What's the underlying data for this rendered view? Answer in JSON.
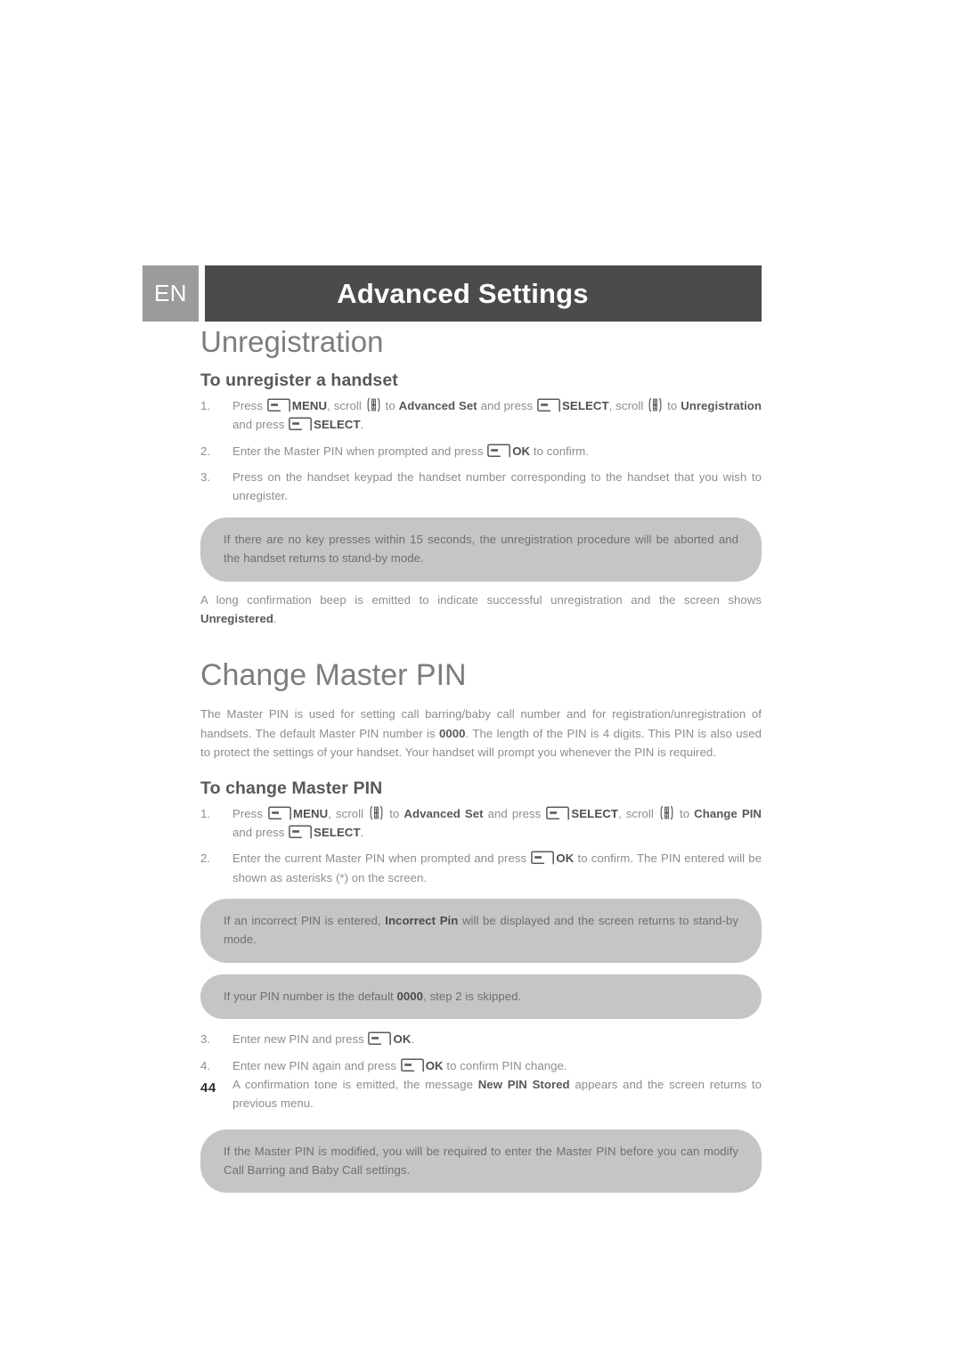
{
  "header": {
    "language_tab": "EN",
    "title": "Advanced Settings",
    "band_color": "#4b4b4b",
    "tab_color": "#9b9b9b"
  },
  "sections": [
    {
      "title": "Unregistration",
      "subsection_title": "To unregister a handset",
      "steps": [
        {
          "number": "1.",
          "parts": [
            {
              "t": "text",
              "v": "Press "
            },
            {
              "t": "icon",
              "v": "softkey-icon"
            },
            {
              "t": "cmd",
              "v": "MENU"
            },
            {
              "t": "text",
              "v": ", scroll "
            },
            {
              "t": "icon",
              "v": "scroll-icon"
            },
            {
              "t": "text",
              "v": " to "
            },
            {
              "t": "term",
              "v": "Advanced Set"
            },
            {
              "t": "text",
              "v": " and press "
            },
            {
              "t": "icon",
              "v": "softkey-icon"
            },
            {
              "t": "cmd",
              "v": "SELECT"
            },
            {
              "t": "text",
              "v": ", scroll "
            },
            {
              "t": "icon",
              "v": "scroll-icon"
            },
            {
              "t": "text",
              "v": " to "
            },
            {
              "t": "term",
              "v": "Unregistration"
            },
            {
              "t": "text",
              "v": " and press "
            },
            {
              "t": "icon",
              "v": "softkey-icon"
            },
            {
              "t": "cmd",
              "v": "SELECT"
            },
            {
              "t": "text",
              "v": "."
            }
          ]
        },
        {
          "number": "2.",
          "parts": [
            {
              "t": "text",
              "v": "Enter the Master PIN when prompted and press "
            },
            {
              "t": "icon",
              "v": "softkey-icon"
            },
            {
              "t": "cmd",
              "v": "OK"
            },
            {
              "t": "text",
              "v": " to confirm."
            }
          ]
        },
        {
          "number": "3.",
          "parts": [
            {
              "t": "text",
              "v": "Press on the handset keypad the handset number corresponding to the handset that you wish to unregister."
            }
          ]
        }
      ],
      "callout": {
        "text_parts": [
          {
            "t": "text",
            "v": "If there are no key presses within 15 seconds, the unregistration procedure will be aborted and the handset returns to stand-by mode."
          }
        ]
      },
      "note_parts": [
        {
          "t": "text",
          "v": "A long confirmation beep is emitted to indicate successful unregistration and the screen shows "
        },
        {
          "t": "term",
          "v": "Unregistered"
        },
        {
          "t": "text",
          "v": "."
        }
      ]
    },
    {
      "title": "Change Master PIN",
      "intro_parts": [
        {
          "t": "text",
          "v": "The Master PIN is used for setting call barring/baby call number and for registration/unregistration of handsets. The default Master PIN number is "
        },
        {
          "t": "term",
          "v": "0000"
        },
        {
          "t": "text",
          "v": ". The length of the PIN is 4 digits. This PIN is also used to protect the settings of your handset. Your handset will prompt you whenever the PIN is required."
        }
      ],
      "subsection_title": "To change Master PIN",
      "steps": [
        {
          "number": "1.",
          "parts": [
            {
              "t": "text",
              "v": "Press "
            },
            {
              "t": "icon",
              "v": "softkey-icon"
            },
            {
              "t": "cmd",
              "v": "MENU"
            },
            {
              "t": "text",
              "v": ", scroll "
            },
            {
              "t": "icon",
              "v": "scroll-icon"
            },
            {
              "t": "text",
              "v": " to "
            },
            {
              "t": "term",
              "v": "Advanced Set"
            },
            {
              "t": "text",
              "v": " and press "
            },
            {
              "t": "icon",
              "v": "softkey-icon"
            },
            {
              "t": "cmd",
              "v": "SELECT"
            },
            {
              "t": "text",
              "v": ", scroll "
            },
            {
              "t": "icon",
              "v": "scroll-icon"
            },
            {
              "t": "text",
              "v": " to "
            },
            {
              "t": "term",
              "v": "Change PIN"
            },
            {
              "t": "text",
              "v": " and press "
            },
            {
              "t": "icon",
              "v": "softkey-icon"
            },
            {
              "t": "cmd",
              "v": "SELECT"
            },
            {
              "t": "text",
              "v": "."
            }
          ]
        },
        {
          "number": "2.",
          "parts": [
            {
              "t": "text",
              "v": "Enter the current Master PIN when prompted and press "
            },
            {
              "t": "icon",
              "v": "softkey-icon"
            },
            {
              "t": "cmd",
              "v": "OK"
            },
            {
              "t": "text",
              "v": " to confirm. The PIN entered will be shown as asterisks (*) on the screen."
            }
          ]
        }
      ],
      "callouts": [
        {
          "text_parts": [
            {
              "t": "text",
              "v": "If an incorrect PIN is entered, "
            },
            {
              "t": "term",
              "v": "Incorrect Pin"
            },
            {
              "t": "text",
              "v": " will be displayed and the screen returns to stand-by mode."
            }
          ]
        },
        {
          "text_parts": [
            {
              "t": "text",
              "v": "If your PIN number is the default "
            },
            {
              "t": "term",
              "v": "0000"
            },
            {
              "t": "text",
              "v": ", step 2 is skipped."
            }
          ]
        }
      ],
      "steps_after": [
        {
          "number": "3.",
          "parts": [
            {
              "t": "text",
              "v": "Enter new PIN and press "
            },
            {
              "t": "icon",
              "v": "softkey-icon"
            },
            {
              "t": "cmd",
              "v": "OK"
            },
            {
              "t": "text",
              "v": "."
            }
          ]
        },
        {
          "number": "4.",
          "parts": [
            {
              "t": "text",
              "v": "Enter new PIN again and press "
            },
            {
              "t": "icon",
              "v": "softkey-icon"
            },
            {
              "t": "cmd",
              "v": "OK"
            },
            {
              "t": "text",
              "v": " to confirm PIN change."
            }
          ],
          "sub_parts": [
            {
              "t": "text",
              "v": "A confirmation tone is emitted, the message "
            },
            {
              "t": "term",
              "v": "New PIN Stored"
            },
            {
              "t": "text",
              "v": " appears and the screen returns to previous menu."
            }
          ]
        }
      ],
      "final_callout": {
        "text_parts": [
          {
            "t": "text",
            "v": "If the Master PIN is modified, you will be required to enter the Master PIN before you can modify Call Barring and Baby Call settings."
          }
        ]
      }
    }
  ],
  "footer": {
    "page_number": "44"
  }
}
